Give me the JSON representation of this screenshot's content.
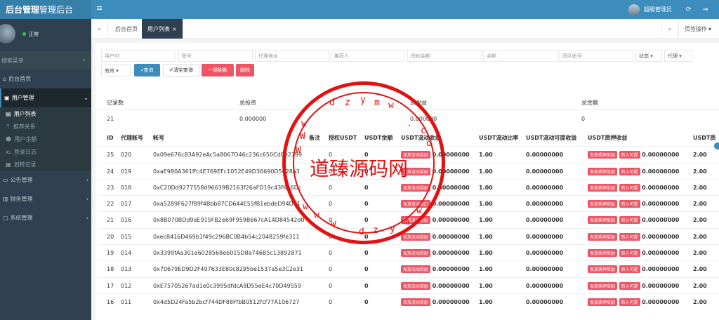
{
  "app": {
    "logo_bold": "后台管理",
    "logo_light": "管理后台",
    "admin_name": "超级管理员"
  },
  "sidebar": {
    "status": "正常",
    "search_placeholder": "搜索菜单",
    "home": "后台首页",
    "user_mgmt": "用户管理",
    "sub_items": [
      "用户列表",
      "推荐关系",
      "用户余额",
      "登录日志",
      "划转记录"
    ],
    "announcement": "公告管理",
    "finance": "财务管理",
    "system": "系统管理"
  },
  "tabs": {
    "home": "后台首页",
    "user_list": "用户列表",
    "page_ops": "页签操作"
  },
  "filters": {
    "user_id": "用户ID",
    "account": "账号",
    "proxy_addr": "代理地址",
    "referrer": "推荐人",
    "auth_amount": "授权金额",
    "balance": "余额",
    "team_account": "团队账号",
    "status": "状态",
    "proxy": "代理",
    "valid": "有效",
    "btn_query": "查询",
    "btn_clear": "清空查询",
    "btn_refresh": "一键刷新",
    "btn_delete": "删除"
  },
  "summary": {
    "headers": [
      "记录数",
      "总投资",
      "总收益",
      "总余额"
    ],
    "values": [
      "21",
      "0.000000",
      "0.000000",
      "0"
    ]
  },
  "table": {
    "columns": [
      "ID",
      "代理账号",
      "帐号",
      "备注",
      "授权USDT",
      "USDT余额",
      "USDT流动收益",
      "USDT流动比率",
      "USDT流动可提收益",
      "USDT质押收益",
      "USDT质"
    ],
    "tag_liquid": "发放流动奖励",
    "tag_pledge": "发放质押奖励",
    "tag_transfer": "转入可提",
    "rows": [
      {
        "id": "25",
        "agent": "020",
        "addr": "0x09e676c83A92eAc5a8067D46c236c650Cd0e2799",
        "auth": "0",
        "bal": "0",
        "liq": "0.00000000",
        "ratio": "1.00",
        "liq_w": "0.00000000",
        "pledge": "0.00000000",
        "last": "2.00"
      },
      {
        "id": "24",
        "agent": "019",
        "addr": "0xaE980A361ffc4E769EFc1052E49D36690D5628a3",
        "auth": "0",
        "bal": "0",
        "liq": "0.00000000",
        "ratio": "1.00",
        "liq_w": "0.00000000",
        "pledge": "0.00000000",
        "last": "2.00"
      },
      {
        "id": "23",
        "agent": "018",
        "addr": "0xC20Dd9277558d96639B2163f26aFD19c43f6A6Dc",
        "auth": "0",
        "bal": "0",
        "liq": "0.00000000",
        "ratio": "1.00",
        "liq_w": "0.00000000",
        "pledge": "0.00000000",
        "last": "2.00"
      },
      {
        "id": "22",
        "agent": "017",
        "addr": "0xa5289F627f89f4Bbb87CD644E55fB1ebdeD94D71",
        "auth": "0",
        "bal": "0",
        "liq": "0.00000000",
        "ratio": "1.00",
        "liq_w": "0.00000000",
        "pledge": "0.00000000",
        "last": "2.00"
      },
      {
        "id": "21",
        "agent": "016",
        "addr": "0x8B070BDd9aE915FB2e69F959B667cA14D84542d0",
        "auth": "0",
        "bal": "0",
        "liq": "0.00000000",
        "ratio": "1.00",
        "liq_w": "0.00000000",
        "pledge": "0.00000000",
        "last": "2.00"
      },
      {
        "id": "20",
        "agent": "015",
        "addr": "0xec8416D469b1f49c296BC0B4b54c2048259fe311",
        "auth": "0",
        "bal": "0",
        "liq": "0.00000000",
        "ratio": "1.00",
        "liq_w": "0.00000000",
        "pledge": "0.00000000",
        "last": "2.00"
      },
      {
        "id": "19",
        "agent": "014",
        "addr": "0x3399fAa301e6028568eb015D8a746B5c13892871",
        "auth": "0",
        "bal": "0",
        "liq": "0.00000000",
        "ratio": "1.00",
        "liq_w": "0.00000000",
        "pledge": "0.00000000",
        "last": "2.00"
      },
      {
        "id": "18",
        "agent": "013",
        "addr": "0x70679ED9D2F497633E80c8295be1537a5e3C2e31",
        "auth": "0",
        "bal": "0",
        "liq": "0.00000000",
        "ratio": "1.00",
        "liq_w": "0.00000000",
        "pledge": "0.00000000",
        "last": "2.00"
      },
      {
        "id": "17",
        "agent": "012",
        "addr": "0xE75705267ad1e0c3995dfdcA9D55eE4c70D49559",
        "auth": "0",
        "bal": "0",
        "liq": "0.00000000",
        "ratio": "1.00",
        "liq_w": "0.00000000",
        "pledge": "0.00000000",
        "last": "2.00"
      },
      {
        "id": "16",
        "agent": "011",
        "addr": "0x4d5D24Fa5b2bcf744DF88FfbB0512fcf77A106727",
        "auth": "0",
        "bal": "0",
        "liq": "0.00000000",
        "ratio": "1.00",
        "liq_w": "0.00000000",
        "pledge": "0.00000000",
        "last": "2.00"
      }
    ]
  },
  "watermark": {
    "text": "道臻源码网",
    "domain_chars": [
      "d",
      "z",
      "y",
      "m",
      "w",
      ".",
      "c",
      "o",
      "m"
    ]
  },
  "colors": {
    "topbar": "#3c8dbc",
    "sidebar": "#2f4050",
    "primary": "#3c8dbc",
    "danger": "#ed5565",
    "stamp": "#e21212"
  }
}
